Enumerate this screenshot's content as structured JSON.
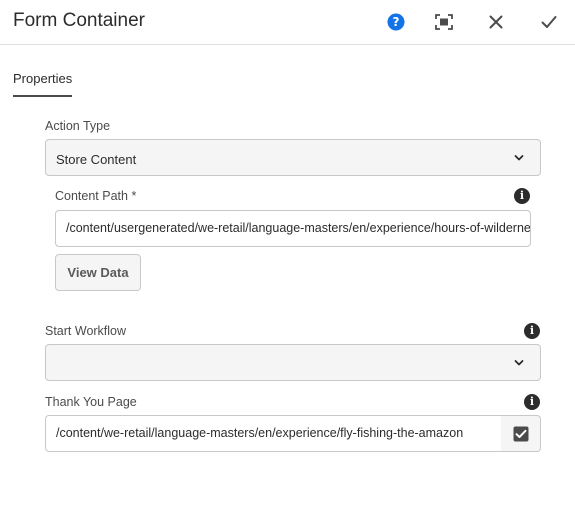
{
  "header": {
    "title": "Form Container",
    "icons": [
      "help-icon",
      "fullscreen-icon",
      "close-icon",
      "check-icon"
    ],
    "accent_color": "#1473e6"
  },
  "tabs": [
    {
      "label": "Properties",
      "active": true
    }
  ],
  "form": {
    "action_type": {
      "label": "Action Type",
      "value": "Store Content"
    },
    "content_path": {
      "label": "Content Path *",
      "value": "/content/usergenerated/we-retail/language-masters/en/experience/hours-of-wilderne"
    },
    "view_data_label": "View Data",
    "start_workflow": {
      "label": "Start Workflow",
      "value": ""
    },
    "thank_you_page": {
      "label": "Thank You Page",
      "value": "/content/we-retail/language-masters/en/experience/fly-fishing-the-amazon"
    }
  }
}
